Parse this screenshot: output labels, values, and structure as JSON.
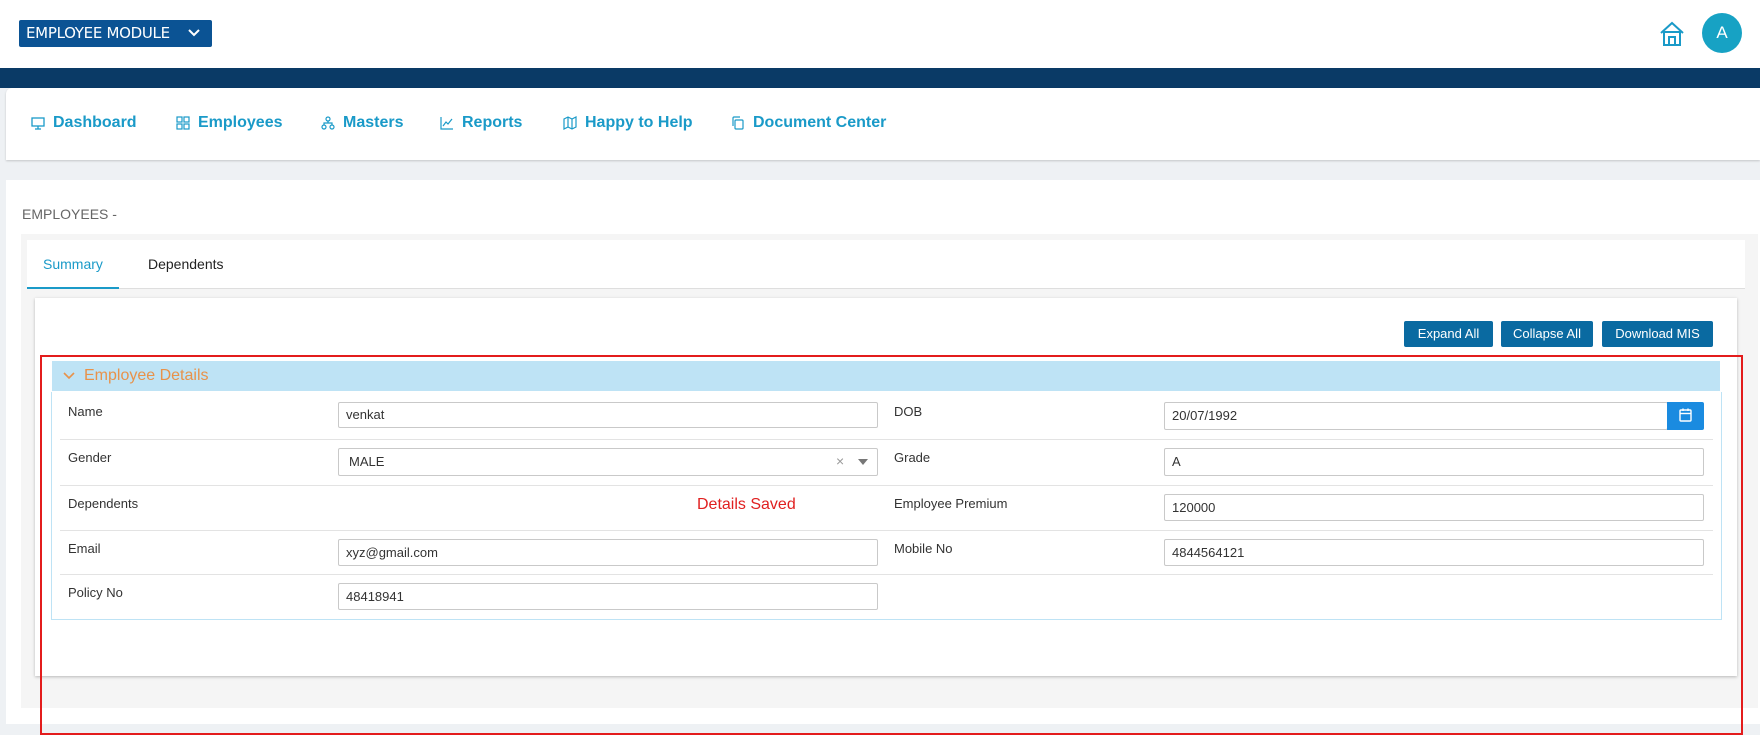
{
  "header": {
    "module_label": "EMPLOYEE MODULE",
    "avatar_initial": "A",
    "icons": [
      "chevron-down-icon",
      "home-icon"
    ]
  },
  "nav": {
    "items": [
      {
        "label": "Dashboard",
        "icon": "monitor-icon"
      },
      {
        "label": "Employees",
        "icon": "grid-icon"
      },
      {
        "label": "Masters",
        "icon": "sitemap-icon"
      },
      {
        "label": "Reports",
        "icon": "line-chart-icon"
      },
      {
        "label": "Happy to Help",
        "icon": "map-icon"
      },
      {
        "label": "Document Center",
        "icon": "copy-icon"
      }
    ]
  },
  "page": {
    "title": "EMPLOYEES -",
    "tabs": [
      {
        "label": "Summary",
        "active": true
      },
      {
        "label": "Dependents",
        "active": false
      }
    ],
    "buttons": {
      "expand_all": "Expand All",
      "collapse_all": "Collapse All",
      "download_mis": "Download MIS"
    },
    "section_title": "Employee Details",
    "saved_message": "Details Saved"
  },
  "form": {
    "name": {
      "label": "Name",
      "value": "venkat"
    },
    "dob": {
      "label": "DOB",
      "value": "20/07/1992"
    },
    "gender": {
      "label": "Gender",
      "value": "MALE",
      "clear": "×"
    },
    "grade": {
      "label": "Grade",
      "value": "A"
    },
    "dependents": {
      "label": "Dependents"
    },
    "premium": {
      "label": "Employee Premium",
      "value": "120000"
    },
    "email": {
      "label": "Email",
      "value": "xyz@gmail.com"
    },
    "mobile": {
      "label": "Mobile No",
      "value": "4844564121"
    },
    "policy": {
      "label": "Policy No",
      "value": "48418941"
    }
  },
  "colors": {
    "brand_dark": "#0a3a66",
    "module_button": "#0b5394",
    "accent": "#1a9ac8",
    "section_title": "#e8924a",
    "highlight_box": "#e31c1c",
    "saved_text": "#e02020"
  }
}
